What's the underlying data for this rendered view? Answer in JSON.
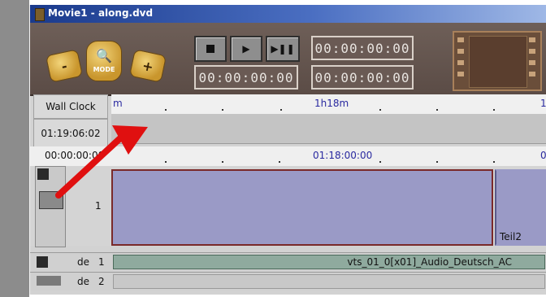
{
  "window": {
    "title": "Movie1 - along.dvd"
  },
  "toolbar": {
    "zoom_minus": "-",
    "zoom_mode_label": "MODE",
    "zoom_plus": "+",
    "stop_icon": "stop-icon",
    "play_icon": "play-icon",
    "step_icon": "play-step-icon",
    "timecode_top_right": "00:00:00:00",
    "timecode_bottom_left": "00:00:00:00",
    "timecode_bottom_right": "00:00:00:00"
  },
  "timeline": {
    "wall_clock_label": "Wall Clock",
    "wall_clock_value": "01:19:06:02",
    "ruler_top": {
      "left_label": "m",
      "middle_label": "1h18m",
      "right_label": "1"
    },
    "ruler_bottom": {
      "left_label": "00:00:00:00",
      "middle_label": "01:18:00:00",
      "right_label": "0"
    },
    "video_track": {
      "number": "1",
      "clip_right_label": "Teil2"
    },
    "audio_tracks": [
      {
        "lang": "de",
        "number": "1",
        "clip_label": "vts_01_0[x01]_Audio_Deutsch_AC"
      },
      {
        "lang": "de",
        "number": "2",
        "clip_label": ""
      }
    ]
  },
  "colors": {
    "titlebar": "#1a3a8c",
    "toolbar_bg": "#5b4c46",
    "clip_fill": "#9a9ac6",
    "audio_clip_fill": "#8faa9e",
    "annotation_arrow": "#e01010"
  }
}
